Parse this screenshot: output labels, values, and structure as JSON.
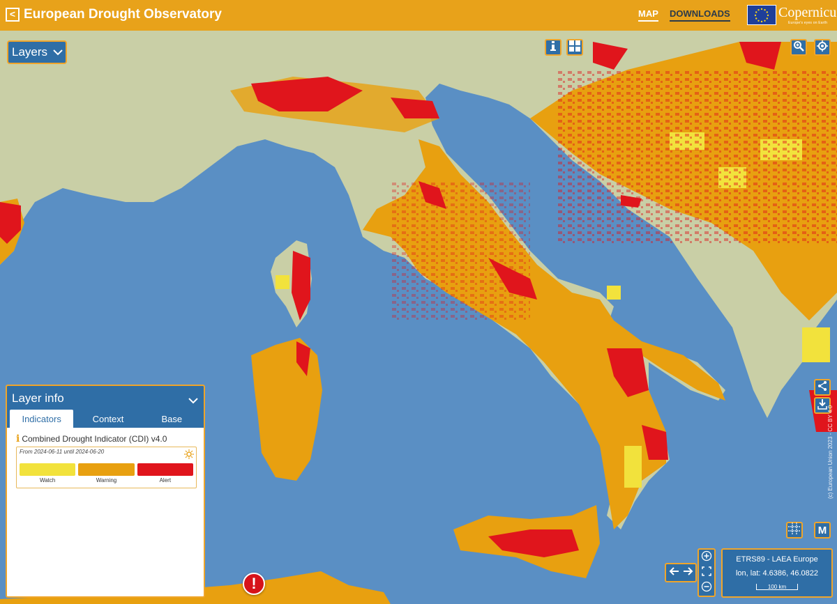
{
  "header": {
    "back_label": "<",
    "title": "European Drought Observatory",
    "nav": {
      "map": "MAP",
      "downloads": "DOWNLOADS"
    },
    "brand": {
      "name": "Copernicus",
      "tagline": "Europe's eyes on Earth"
    }
  },
  "controls": {
    "layers_label": "Layers"
  },
  "layer_info": {
    "title": "Layer info",
    "tabs": [
      "Indicators",
      "Context",
      "Base"
    ],
    "active_tab": "Indicators",
    "layer_name": "Combined Drought Indicator (CDI) v4.0",
    "period": "From 2024-06-11 until 2024-06-20",
    "legend": [
      {
        "label": "Watch",
        "color": "#f2e23c"
      },
      {
        "label": "Warning",
        "color": "#e8a010"
      },
      {
        "label": "Alert",
        "color": "#e0151c"
      }
    ]
  },
  "projection": {
    "name": "ETRS89 - LAEA Europe",
    "coords": "lon, lat: 4.6386, 46.0822",
    "scale": "100 km"
  },
  "attribution": "(c) European Union 2023 - CC BY 4.0",
  "map_colors": {
    "sea": "#5a8fc4",
    "land": "#c9cfa6",
    "watch": "#f2e23c",
    "warning": "#e8a010",
    "alert": "#e0151c",
    "ui_blue": "#2f6ea6",
    "ui_orange": "#e8a21a"
  }
}
